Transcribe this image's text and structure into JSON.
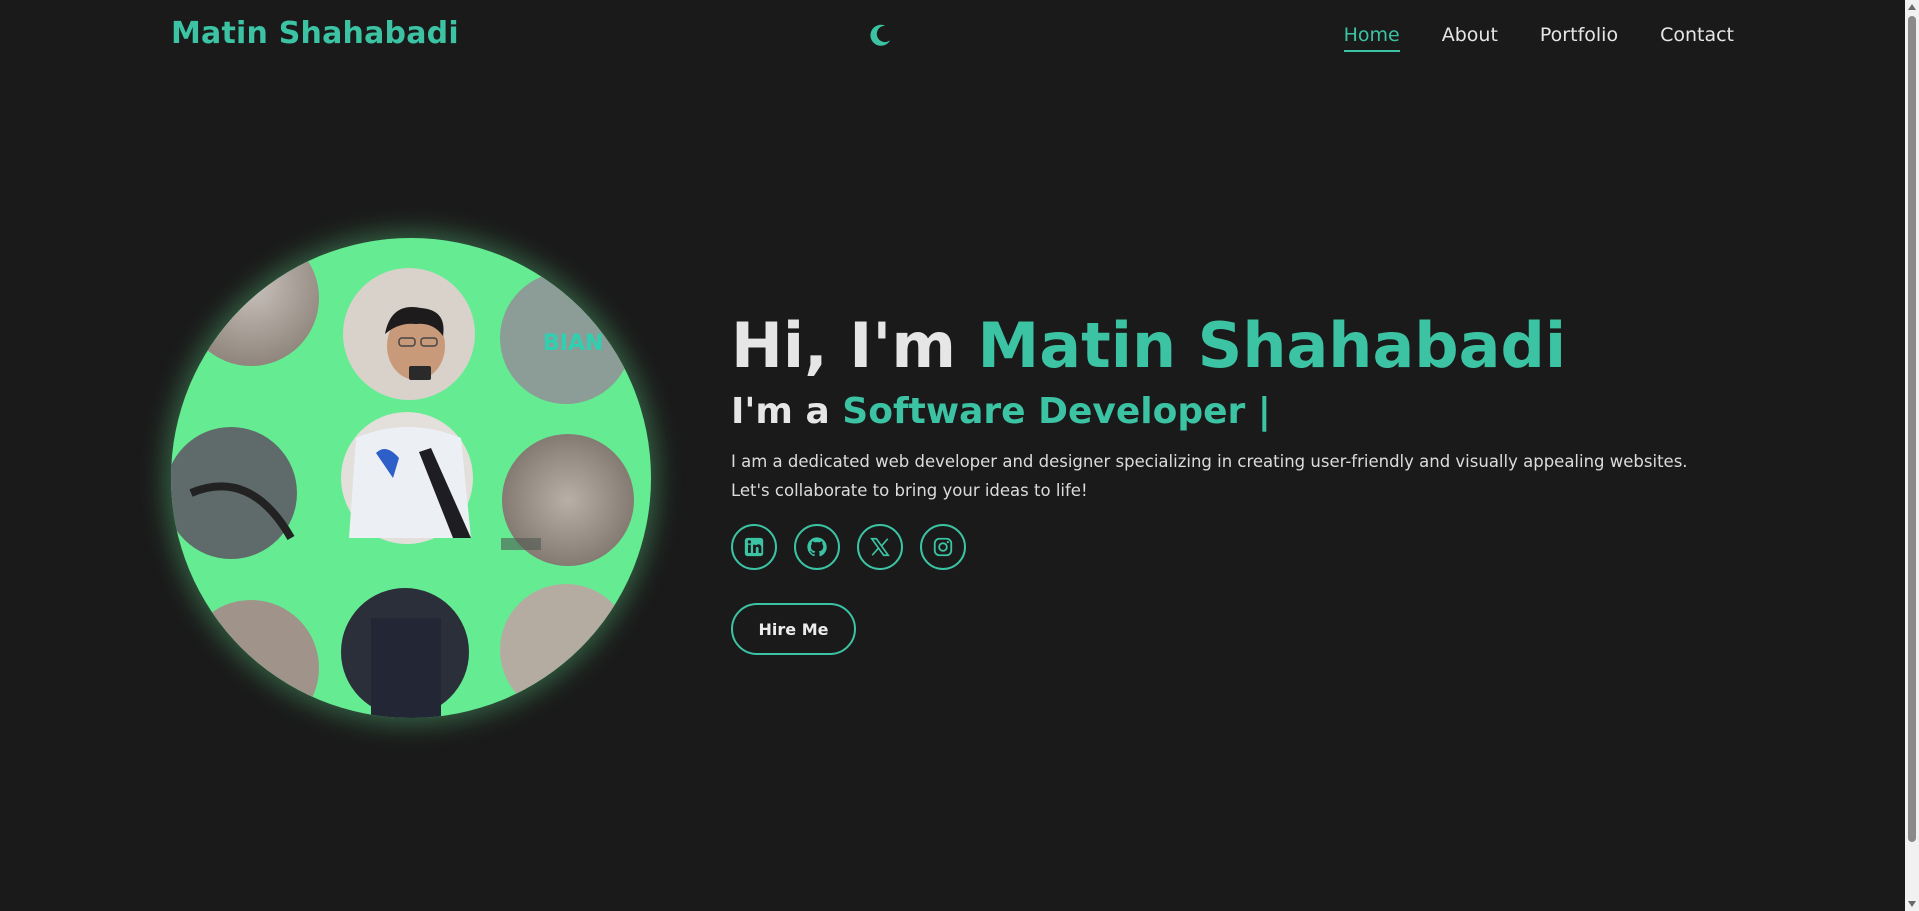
{
  "header": {
    "logo": "Matin Shahabadi",
    "theme_toggle_icon": "moon-icon",
    "nav": [
      {
        "label": "Home",
        "active": true
      },
      {
        "label": "About",
        "active": false
      },
      {
        "label": "Portfolio",
        "active": false
      },
      {
        "label": "Contact",
        "active": false
      }
    ]
  },
  "hero": {
    "greeting_prefix": "Hi, I'm ",
    "name": "Matin Shahabadi",
    "role_prefix": "I'm a ",
    "role": "Software Developer |",
    "bio": "I am a dedicated web developer and designer specializing in creating user-friendly and visually appealing websites. Let's collaborate to bring your ideas to life!",
    "socials": [
      {
        "icon": "linkedin-icon"
      },
      {
        "icon": "github-icon"
      },
      {
        "icon": "x-twitter-icon"
      },
      {
        "icon": "instagram-icon"
      }
    ],
    "cta_label": "Hire Me"
  },
  "avatar": {
    "icon": "profile-photo",
    "sign_text": "BIAN"
  },
  "colors": {
    "accent": "#3cc3a3",
    "background": "#1a1a1a",
    "text": "#e6e6e6",
    "photo_green": "#6ef29a"
  }
}
